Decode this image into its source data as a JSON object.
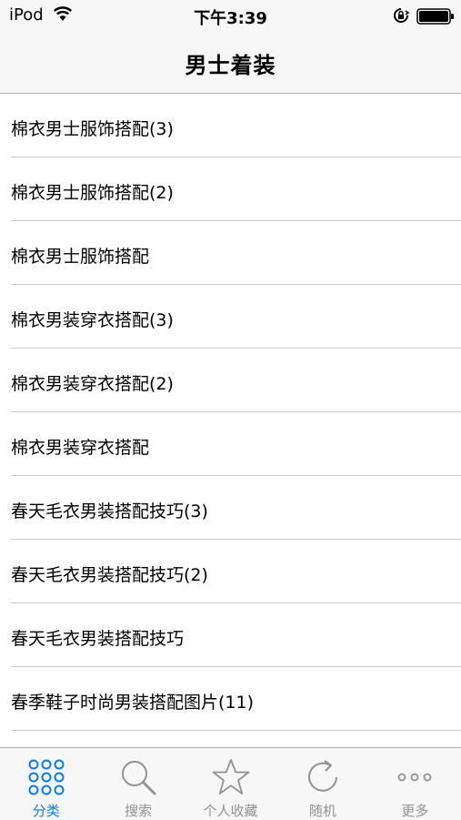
{
  "status_bar": {
    "carrier": "iPod",
    "time": "下午3:39"
  },
  "nav": {
    "title": "男士着装"
  },
  "list": {
    "items": [
      "棉衣男士服饰搭配(3)",
      "棉衣男士服饰搭配(2)",
      "棉衣男士服饰搭配",
      "棉衣男装穿衣搭配(3)",
      "棉衣男装穿衣搭配(2)",
      "棉衣男装穿衣搭配",
      "春天毛衣男装搭配技巧(3)",
      "春天毛衣男装搭配技巧(2)",
      "春天毛衣男装搭配技巧",
      "春季鞋子时尚男装搭配图片(11)",
      ""
    ]
  },
  "tab_bar": {
    "tabs": [
      {
        "label": "分类",
        "icon": "grid-icon",
        "active": true
      },
      {
        "label": "搜索",
        "icon": "search-icon",
        "active": false
      },
      {
        "label": "个人收藏",
        "icon": "star-icon",
        "active": false
      },
      {
        "label": "随机",
        "icon": "refresh-icon",
        "active": false
      },
      {
        "label": "更多",
        "icon": "more-icon",
        "active": false
      }
    ]
  },
  "colors": {
    "accent": "#0a7be5",
    "inactive": "#929292",
    "bar_background": "#f7f7f7"
  }
}
